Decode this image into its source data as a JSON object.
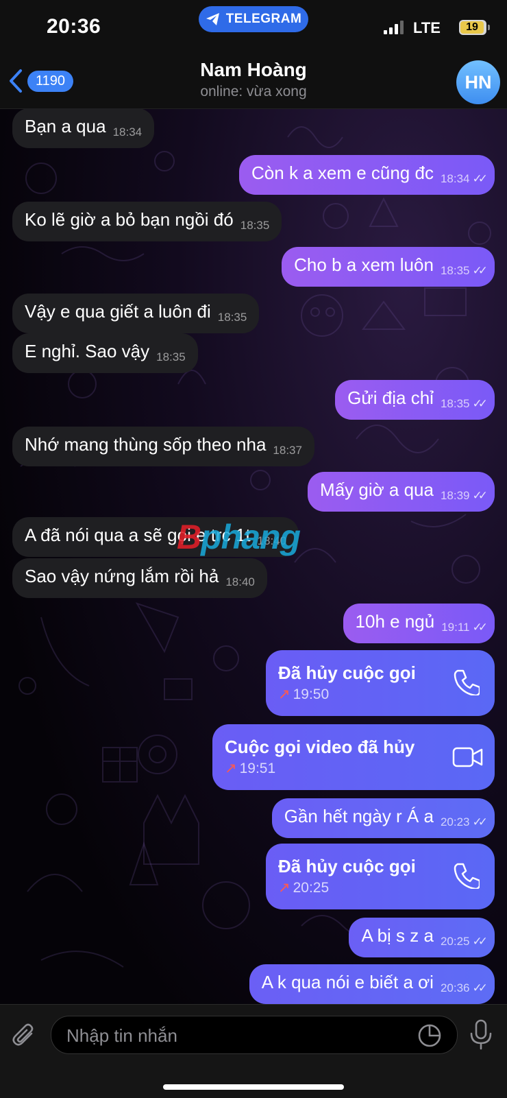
{
  "status_bar": {
    "time": "20:36",
    "app_pill": "TELEGRAM",
    "network": "LTE",
    "battery": "19"
  },
  "header": {
    "back_count": "1190",
    "title": "Nam Hoàng",
    "subtitle": "online: vừa xong",
    "avatar_initials": "HN"
  },
  "messages": [
    {
      "dir": "in",
      "text": "Bạn a qua",
      "time": "18:34"
    },
    {
      "dir": "out",
      "text": "Còn k a xem e cũng đc",
      "time": "18:34"
    },
    {
      "dir": "in",
      "text": "Ko lẽ giờ a bỏ bạn ngồi đó",
      "time": "18:35"
    },
    {
      "dir": "out",
      "text": "Cho b a xem luôn",
      "time": "18:35"
    },
    {
      "dir": "in",
      "text": "Vậy e qua giết a luôn đi",
      "time": "18:35"
    },
    {
      "dir": "in",
      "text": "E nghỉ. Sao vậy",
      "time": "18:35"
    },
    {
      "dir": "out",
      "text": "Gửi địa chỉ",
      "time": "18:35"
    },
    {
      "dir": "in",
      "text": "Nhớ mang thùng sốp theo nha",
      "time": "18:37"
    },
    {
      "dir": "out",
      "text": "Mấy giờ a qua",
      "time": "18:39"
    },
    {
      "dir": "in",
      "text": "A đã nói qua a sẽ gọi e trc 1t",
      "time": "18:40"
    },
    {
      "dir": "in",
      "text": "Sao vậy nứng lắm rồi hả",
      "time": "18:40"
    },
    {
      "dir": "out",
      "text": "10h e ngủ",
      "time": "19:11"
    },
    {
      "dir": "call",
      "text": "Đã hủy cuộc gọi",
      "time": "19:50",
      "icon": "phone-icon"
    },
    {
      "dir": "call",
      "text": "Cuộc gọi video đã hủy",
      "time": "19:51",
      "icon": "video-camera-icon"
    },
    {
      "dir": "out",
      "text": "Gần hết ngày r Á a",
      "time": "20:23"
    },
    {
      "dir": "call",
      "text": "Đã hủy cuộc gọi",
      "time": "20:25",
      "icon": "phone-icon"
    },
    {
      "dir": "out",
      "text": "A bị s z a",
      "time": "20:25"
    },
    {
      "dir": "out",
      "text": "A k qua nói e biết a ơi",
      "time": "20:36"
    }
  ],
  "watermark": {
    "red": "B",
    "blue": "phang"
  },
  "input": {
    "placeholder": "Nhập tin nhắn"
  }
}
